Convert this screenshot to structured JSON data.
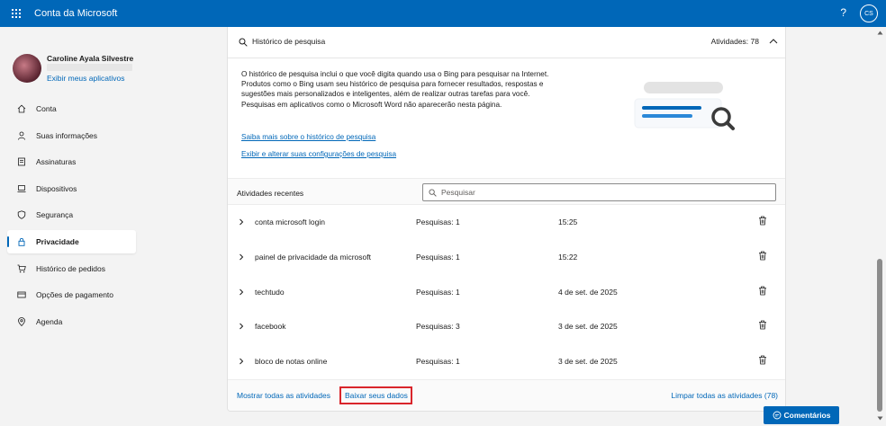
{
  "header": {
    "app_title": "Conta da Microsoft",
    "help_label": "?",
    "user_initials": "CS"
  },
  "profile": {
    "name": "Caroline Ayala Silvestre",
    "apps_link": "Exibir meus aplicativos"
  },
  "nav": {
    "items": [
      {
        "label": "Conta",
        "icon": "home-icon",
        "active": false
      },
      {
        "label": "Suas informações",
        "icon": "person-icon",
        "active": false
      },
      {
        "label": "Assinaturas",
        "icon": "receipt-icon",
        "active": false
      },
      {
        "label": "Dispositivos",
        "icon": "laptop-icon",
        "active": false
      },
      {
        "label": "Segurança",
        "icon": "shield-icon",
        "active": false
      },
      {
        "label": "Privacidade",
        "icon": "lock-icon",
        "active": true
      },
      {
        "label": "Histórico de pedidos",
        "icon": "cart-icon",
        "active": false
      },
      {
        "label": "Opções de pagamento",
        "icon": "card-icon",
        "active": false
      },
      {
        "label": "Agenda",
        "icon": "location-icon",
        "active": false
      }
    ]
  },
  "history": {
    "title": "Histórico de pesquisa",
    "count_label": "Atividades: 78",
    "description": "O histórico de pesquisa inclui o que você digita quando usa o Bing para pesquisar na Internet. Produtos como o Bing usam seu histórico de pesquisa para fornecer resultados, respostas e sugestões mais personalizados e inteligentes, além de realizar outras tarefas para você. Pesquisas em aplicativos como o Microsoft Word não aparecerão nesta página.",
    "learn_more_link": "Saiba mais sobre o histórico de pesquisa",
    "settings_link": "Exibir e alterar suas configurações de pesquisa"
  },
  "recent": {
    "title": "Atividades recentes",
    "search_placeholder": "Pesquisar",
    "rows": [
      {
        "query": "conta microsoft login",
        "count": "Pesquisas: 1",
        "date": "15:25"
      },
      {
        "query": "painel de privacidade da microsoft",
        "count": "Pesquisas: 1",
        "date": "15:22"
      },
      {
        "query": "techtudo",
        "count": "Pesquisas: 1",
        "date": "4 de set. de 2025"
      },
      {
        "query": "facebook",
        "count": "Pesquisas: 3",
        "date": "3 de set. de 2025"
      },
      {
        "query": "bloco de notas online",
        "count": "Pesquisas: 1",
        "date": "3 de set. de 2025"
      }
    ]
  },
  "footer": {
    "show_all": "Mostrar todas as atividades",
    "download": "Baixar seus dados",
    "clear_all": "Limpar todas as atividades (78)"
  },
  "feedback_button": "Comentários",
  "colors": {
    "brand": "#0067b8",
    "highlight": "#d9252b"
  }
}
